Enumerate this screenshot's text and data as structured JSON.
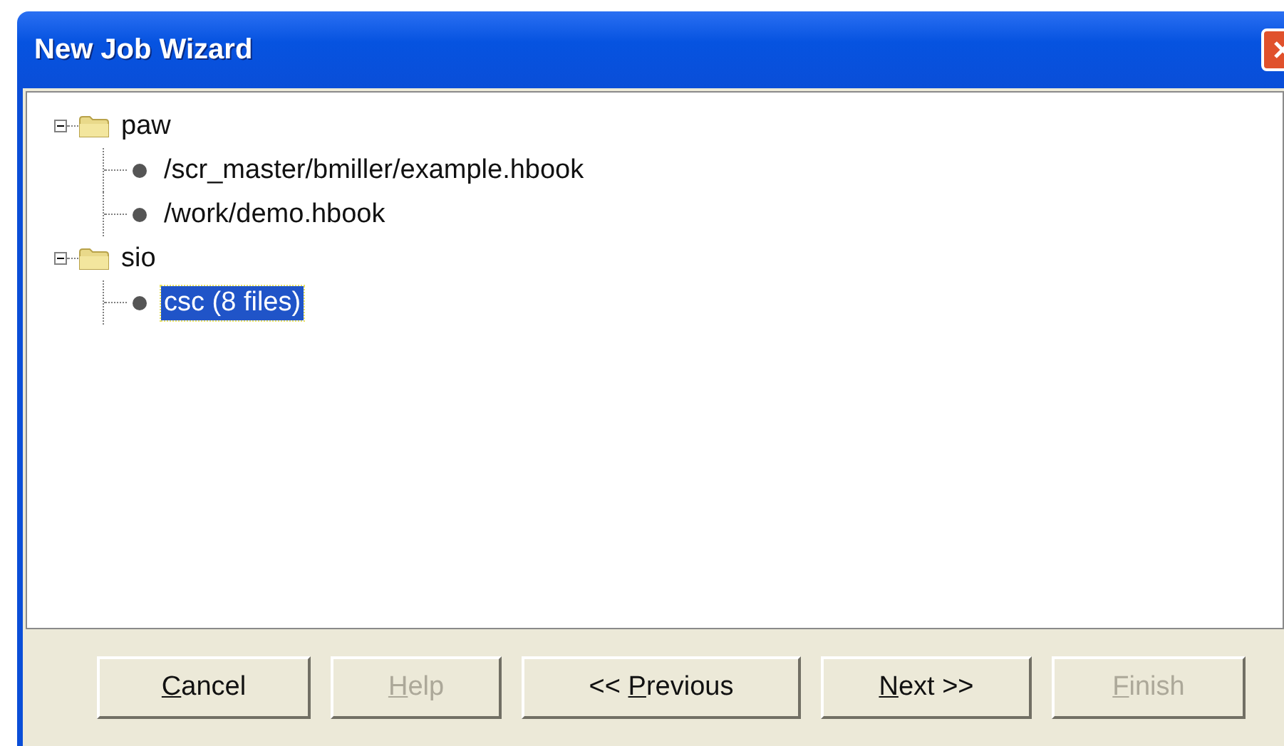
{
  "window": {
    "title": "New Job Wizard"
  },
  "tree": [
    {
      "label": "paw",
      "kind": "folder",
      "expanded": true,
      "selected": false,
      "children": [
        {
          "label": "/scr_master/bmiller/example.hbook",
          "kind": "file",
          "selected": false
        },
        {
          "label": "/work/demo.hbook",
          "kind": "file",
          "selected": false
        }
      ]
    },
    {
      "label": "sio",
      "kind": "folder",
      "expanded": true,
      "selected": false,
      "children": [
        {
          "label": "csc (8 files)",
          "kind": "file",
          "selected": true
        }
      ]
    }
  ],
  "buttons": [
    {
      "key": "C",
      "after": "ancel",
      "disabled": false
    },
    {
      "key": "H",
      "after": "elp",
      "disabled": true
    },
    {
      "before": "<< ",
      "key": "P",
      "after": "revious",
      "disabled": false
    },
    {
      "key": "N",
      "after": "ext >>",
      "disabled": false
    },
    {
      "key": "F",
      "after": "inish",
      "disabled": true
    }
  ]
}
